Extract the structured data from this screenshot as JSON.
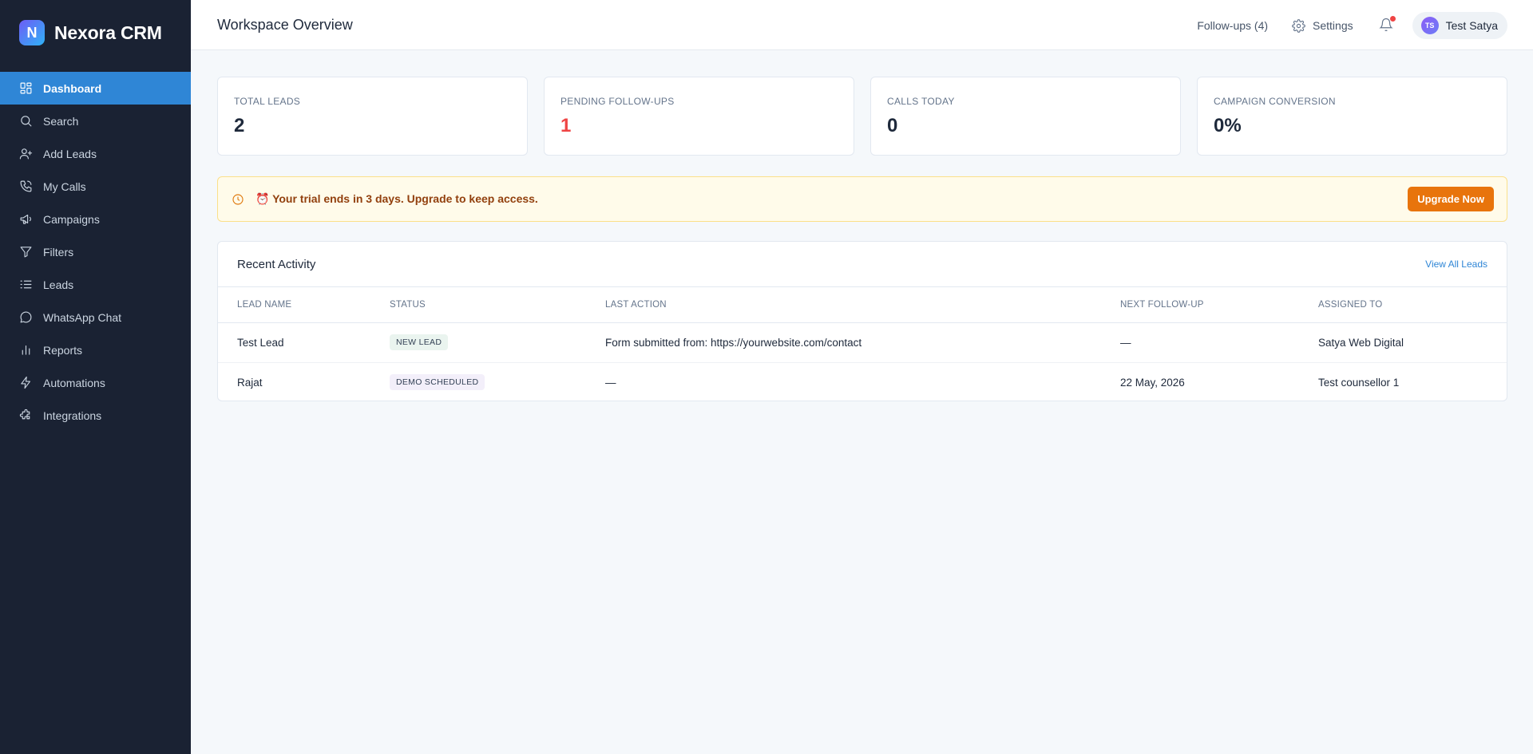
{
  "brand": {
    "logo_letter": "N",
    "name": "Nexora CRM"
  },
  "sidebar": {
    "items": [
      {
        "label": "Dashboard",
        "icon": "dashboard-icon",
        "active": true
      },
      {
        "label": "Search",
        "icon": "search-icon"
      },
      {
        "label": "Add Leads",
        "icon": "add-user-icon"
      },
      {
        "label": "My Calls",
        "icon": "phone-icon"
      },
      {
        "label": "Campaigns",
        "icon": "megaphone-icon"
      },
      {
        "label": "Filters",
        "icon": "filter-icon"
      },
      {
        "label": "Leads",
        "icon": "list-icon"
      },
      {
        "label": "WhatsApp Chat",
        "icon": "chat-icon"
      },
      {
        "label": "Reports",
        "icon": "bar-chart-icon"
      },
      {
        "label": "Automations",
        "icon": "bolt-icon"
      },
      {
        "label": "Integrations",
        "icon": "puzzle-icon"
      }
    ]
  },
  "header": {
    "title": "Workspace Overview",
    "followups_label": "Follow-ups (4)",
    "settings_label": "Settings",
    "user_initials": "TS",
    "user_name": "Test Satya"
  },
  "stats": [
    {
      "label": "TOTAL LEADS",
      "value": "2"
    },
    {
      "label": "PENDING FOLLOW-UPS",
      "value": "1",
      "color": "#ef4444"
    },
    {
      "label": "CALLS TODAY",
      "value": "0"
    },
    {
      "label": "CAMPAIGN CONVERSION",
      "value": "0%"
    }
  ],
  "banner": {
    "text": "⏰ Your trial ends in 3 days. Upgrade to keep access.",
    "button_label": "Upgrade Now"
  },
  "activity": {
    "title": "Recent Activity",
    "view_all_label": "View All Leads",
    "columns": [
      "LEAD NAME",
      "STATUS",
      "LAST ACTION",
      "NEXT FOLLOW-UP",
      "ASSIGNED TO"
    ],
    "rows": [
      {
        "name": "Test Lead",
        "status": "NEW LEAD",
        "last_action": "Form submitted from: https://yourwebsite.com/contact",
        "next_followup": "—",
        "assigned_to": "Satya Web Digital"
      },
      {
        "name": "Rajat",
        "status": "DEMO SCHEDULED",
        "last_action": "—",
        "next_followup": "22 May, 2026",
        "assigned_to": "Test counsellor 1"
      }
    ]
  },
  "colors": {
    "sidebar_bg": "#1a2233",
    "accent": "#2f86d6",
    "warning": "#e8740c",
    "danger": "#ef4444"
  }
}
